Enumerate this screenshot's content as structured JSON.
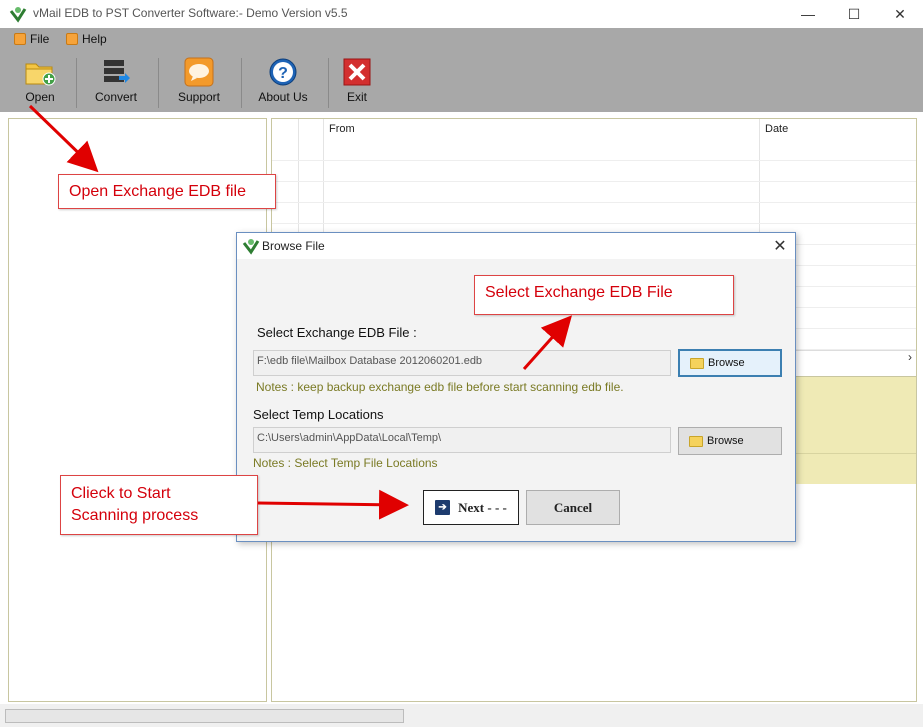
{
  "window": {
    "title": "vMail EDB to PST Converter Software:- Demo Version v5.5",
    "controls": {
      "minimize": "—",
      "maximize": "☐",
      "close": "✕"
    }
  },
  "menu": {
    "items": [
      {
        "label": "File",
        "icon": "file-menu-icon"
      },
      {
        "label": "Help",
        "icon": "help-menu-icon"
      }
    ]
  },
  "toolbar": {
    "buttons": [
      {
        "label": "Open",
        "icon": "open-folder-icon"
      },
      {
        "label": "Convert",
        "icon": "convert-icon"
      },
      {
        "label": "Support",
        "icon": "support-chat-icon"
      },
      {
        "label": "About Us",
        "icon": "about-question-icon"
      },
      {
        "label": "Exit",
        "icon": "exit-x-icon"
      }
    ]
  },
  "grid": {
    "columns": [
      "From",
      "Date"
    ]
  },
  "dialog": {
    "title": "Browse File",
    "close_glyph": "✕",
    "edb_label": "Select Exchange EDB File :",
    "edb_value": "F:\\edb file\\Mailbox Database 2012060201.edb",
    "browse_label": "Browse",
    "edb_note": "Notes : keep backup exchange edb file before start scanning edb file.",
    "temp_label": "Select Temp Locations",
    "temp_value": "C:\\Users\\admin\\AppData\\Local\\Temp\\",
    "temp_note": "Notes :  Select Temp File Locations",
    "next_label": "Next - - -",
    "cancel_label": "Cancel"
  },
  "callouts": {
    "open": "Open Exchange EDB file",
    "select": "Select Exchange EDB File",
    "start_line1": "Clieck to Start",
    "start_line2": "Scanning process"
  },
  "colors": {
    "toolbar_bg": "#a8a8a8",
    "callout_text": "#d4000b",
    "callout_arrow": "#e00000",
    "note_text": "#7a7a24",
    "preview_band": "#efeab5"
  }
}
